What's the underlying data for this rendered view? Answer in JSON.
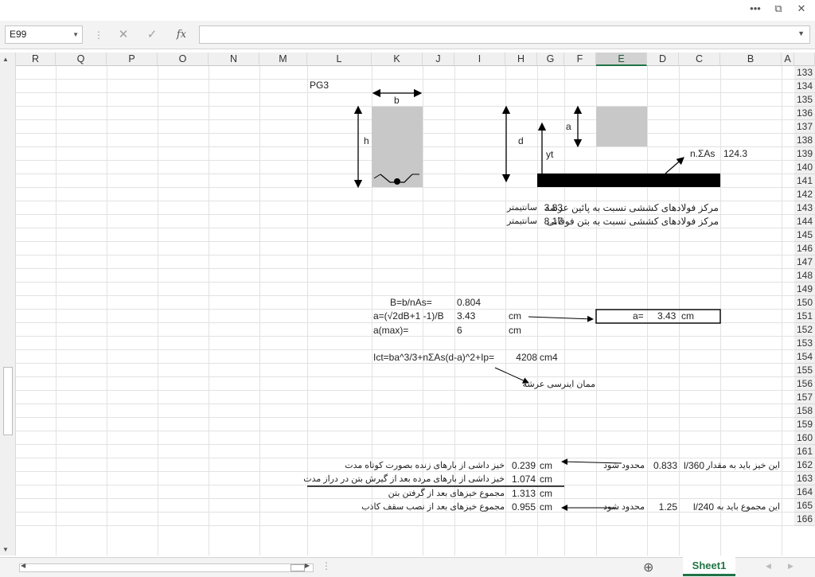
{
  "window": {
    "controls": [
      "•••",
      "⧉",
      "✕"
    ]
  },
  "formula_bar": {
    "name_box": "E99",
    "fx_label": "fx",
    "cancel_icon": "✕",
    "enter_icon": "✓",
    "formula_value": ""
  },
  "columns": [
    "A",
    "B",
    "C",
    "D",
    "E",
    "F",
    "G",
    "H",
    "I",
    "J",
    "K",
    "L",
    "M",
    "N",
    "O",
    "P",
    "Q",
    "R"
  ],
  "selected_column": "E",
  "rows": [
    "133",
    "134",
    "135",
    "136",
    "137",
    "138",
    "139",
    "140",
    "141",
    "142",
    "143",
    "144",
    "145",
    "146",
    "147",
    "148",
    "149",
    "150",
    "151",
    "152",
    "153",
    "154",
    "155",
    "156",
    "157",
    "158",
    "159",
    "160",
    "161",
    "162",
    "163",
    "164",
    "165",
    "166"
  ],
  "diagram": {
    "title": "PG3",
    "b_label": "b",
    "h_label": "h",
    "a_label": "a",
    "d_label": "d",
    "yt_label": "yt",
    "nas_label": "n.ΣAs",
    "nas_value": "124.3"
  },
  "cells": {
    "steel_bottom_label": "مرکز فولادهای کششی نسبت به پائین عرشه",
    "steel_bottom_value": "3.83",
    "steel_bottom_unit": "سانتیمتر",
    "steel_top_label": "مرکز فولادهای کششی نسبت به بتن فوقانی",
    "steel_top_value": "8.17",
    "steel_top_unit": "سانتیمتر",
    "B_label": "B=b/nAs=",
    "B_value": "0.804",
    "a_formula_label": "a=(√2dB+1  -1)/B",
    "a_formula_value": "3.43",
    "a_formula_unit": "cm",
    "a_result_label": "a=",
    "a_result_value": "3.43",
    "a_result_unit": "cm",
    "amax_label": "a(max)=",
    "amax_value": "6",
    "amax_unit": "cm",
    "Ict_label": "Ict=ba^3/3+nΣAs(d-a)^2+Ip=",
    "Ict_value": "4208",
    "Ict_unit": "cm4",
    "inertia_note": "ممان اینرسی عرشه",
    "r162_desc": "خیز داشی از بارهای زنده بصورت کوتاه مدت",
    "r162_value": "0.239",
    "r162_unit": "cm",
    "r162_limit_word": "محدود شود",
    "r162_limit_value": "0.833",
    "r162_limit_ratio": "l/360",
    "r162_limit_text": "این خیز باید به مقدار",
    "r163_desc": "خیز داشی از بارهای مرده بعد از گیرش بتن در دراز مدت",
    "r163_value": "1.074",
    "r163_unit": "cm",
    "r164_desc": "مجموع خیزهای بعد از گرفتن بتن",
    "r164_value": "1.313",
    "r164_unit": "cm",
    "r165_desc": "مجموع خیزهای بعد از نصب سقف کاذب",
    "r165_value": "0.955",
    "r165_unit": "cm",
    "r165_limit_word": "محدود شود",
    "r165_limit_value": "1.25",
    "r165_limit_ratio": "l/240",
    "r165_limit_text": "این مجموع باید به"
  },
  "sheet_tab": "Sheet1",
  "colors": {
    "accent": "#217346",
    "gray_fill": "#c8c8c8"
  }
}
